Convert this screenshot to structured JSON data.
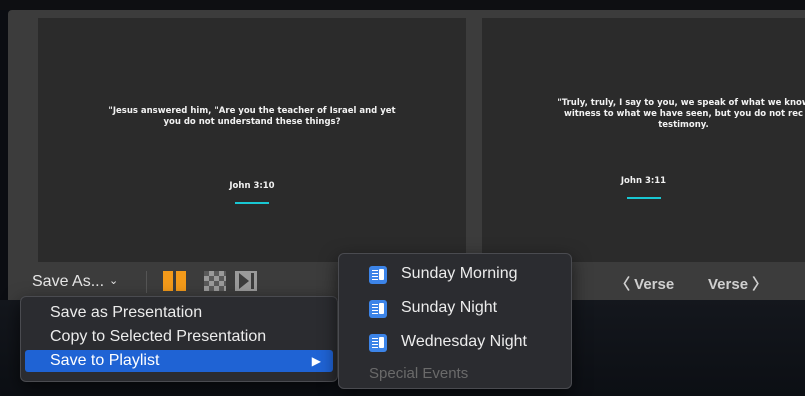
{
  "slides": [
    {
      "text": "\"Jesus answered him, \"Are you the teacher of Israel and yet\nyou do not understand these things?",
      "reference": "John 3:10"
    },
    {
      "text": "\"Truly, truly, I say to you, we speak of what we know\nwitness to what we have seen, but you do not rec\ntestimony.",
      "reference": "John 3:11"
    }
  ],
  "toolbar": {
    "save_as_label": "Save As...",
    "dropdown_icon": "chevron-down-icon",
    "prev_verse_label": "〈 Verse",
    "next_verse_label": "Verse 〉",
    "accent_orange": "#f39a1a"
  },
  "context_menu": {
    "items": [
      {
        "label": "Save as Presentation"
      },
      {
        "label": "Copy to Selected Presentation"
      },
      {
        "label": "Save to Playlist",
        "selected": true,
        "submenu_arrow": "▶"
      }
    ],
    "highlight_color": "#1f63d4"
  },
  "playlist_submenu": {
    "items": [
      {
        "label": "Sunday Morning",
        "icon": "playlist-icon"
      },
      {
        "label": "Sunday Night",
        "icon": "playlist-icon"
      },
      {
        "label": "Wednesday Night",
        "icon": "playlist-icon"
      }
    ],
    "disabled_item": "Special Events"
  },
  "slide_accent_color": "#19c7d3"
}
